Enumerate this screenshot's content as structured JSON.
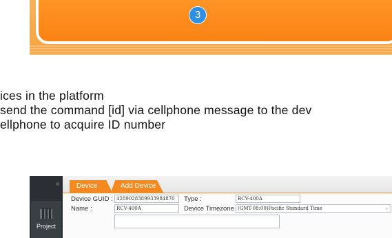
{
  "step": {
    "number": "3"
  },
  "text_lines": [
    "ices in the platform",
    "send the command [id] via cellphone message to the dev",
    "ellphone to acquire ID number"
  ],
  "app": {
    "collapse_glyph": "«",
    "sidebar": {
      "project_label": "Project"
    },
    "tabs": [
      {
        "label": "Device",
        "active": false
      },
      {
        "label": "Add Device",
        "active": true
      }
    ],
    "form": {
      "device_guid": {
        "label": "Device GUID :",
        "value": "4289028389933984870"
      },
      "type": {
        "label": "Type :",
        "value": "RCV-400A"
      },
      "name": {
        "label": "Name :",
        "value": "RCV-400A"
      },
      "timezone": {
        "label": "Device Timezone :",
        "value": "(GMT-08:00)Pacific Standard Time"
      }
    }
  },
  "colors": {
    "accent_orange": "#f48a1f",
    "badge_blue": "#2f8fe5",
    "sidebar_dark": "#2b2f33"
  }
}
